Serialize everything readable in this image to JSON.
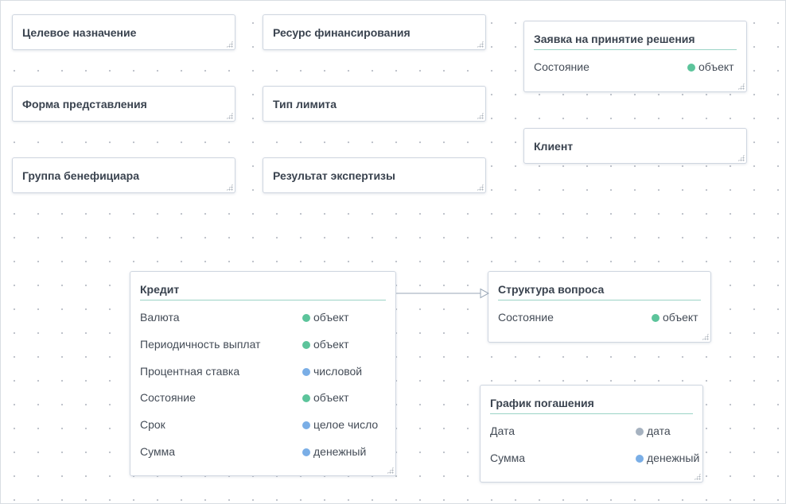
{
  "colors": {
    "object": "#5cc49b",
    "number": "#7aaee6",
    "date": "#a6b2c0",
    "separator": "#9bd3c6"
  },
  "nodes": {
    "celevoe": {
      "title": "Целевое назначение"
    },
    "resurs": {
      "title": "Ресурс финансирования"
    },
    "zayavka": {
      "title": "Заявка на принятие решения",
      "fields": [
        {
          "name": "Состояние",
          "type": "объект"
        }
      ]
    },
    "forma": {
      "title": "Форма представления"
    },
    "tip_limita": {
      "title": "Тип лимита"
    },
    "klient": {
      "title": "Клиент"
    },
    "gruppa": {
      "title": "Группа бенефициара"
    },
    "rezultat": {
      "title": "Результат экспертизы"
    },
    "kredit": {
      "title": "Кредит",
      "fields": [
        {
          "name": "Валюта",
          "type": "объект"
        },
        {
          "name": "Периодичность выплат",
          "type": "объект"
        },
        {
          "name": "Процентная ставка",
          "type": "числовой"
        },
        {
          "name": "Состояние",
          "type": "объект"
        },
        {
          "name": "Срок",
          "type": "целое число"
        },
        {
          "name": "Сумма",
          "type": "денежный"
        }
      ]
    },
    "struktura": {
      "title": "Структура вопроса",
      "fields": [
        {
          "name": "Состояние",
          "type": "объект"
        }
      ]
    },
    "grafik": {
      "title": "График погашения",
      "fields": [
        {
          "name": "Дата",
          "type": "дата"
        },
        {
          "name": "Сумма",
          "type": "денежный"
        }
      ]
    }
  }
}
